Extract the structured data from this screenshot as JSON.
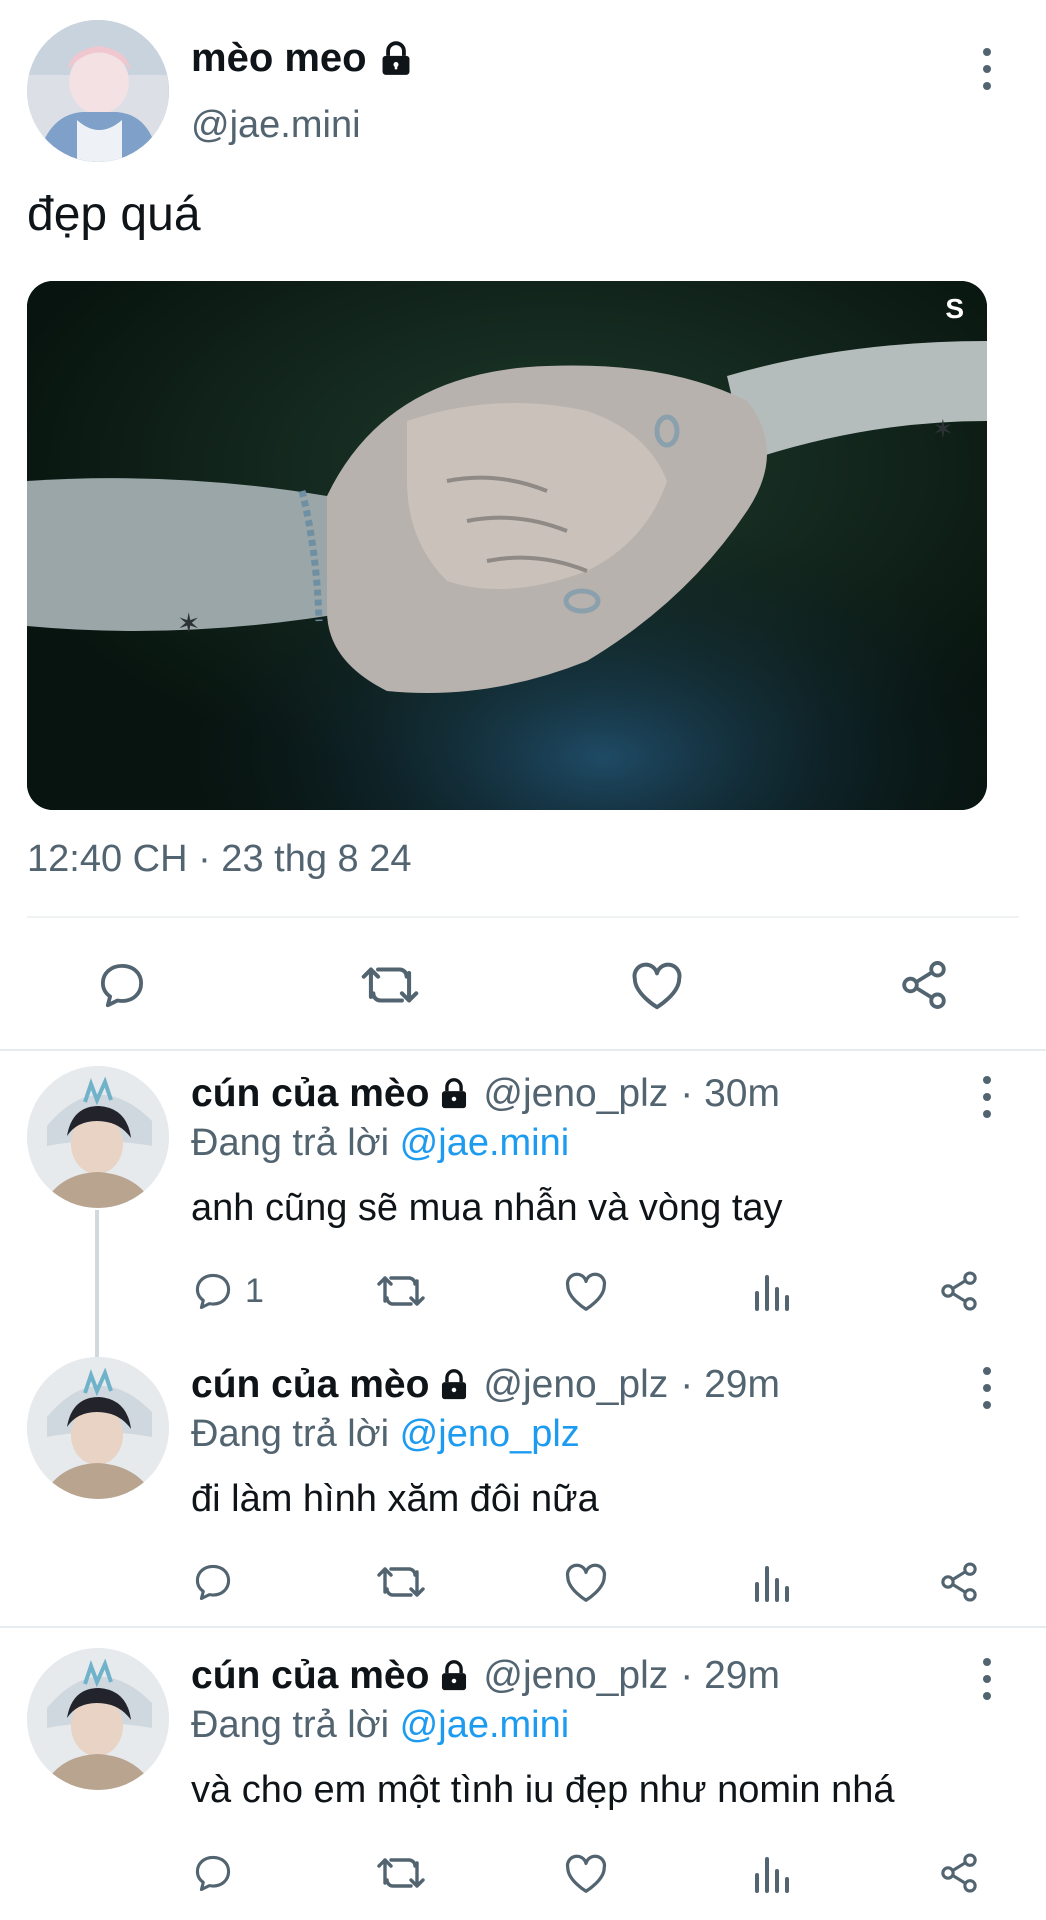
{
  "main_tweet": {
    "author_name": "mèo meo",
    "author_handle": "@jae.mini",
    "text": "đẹp quá",
    "media_watermark": "S",
    "timestamp": "12:40 CH · 23 thg 8 24"
  },
  "replies": [
    {
      "author_name": "cún của mèo",
      "author_handle": "@jeno_plz",
      "age": "· 30m",
      "replying_prefix": "Đang trả lời",
      "replying_to": "@jae.mini",
      "text": "anh cũng sẽ mua nhẫn và vòng tay",
      "reply_count": "1"
    },
    {
      "author_name": "cún của mèo",
      "author_handle": "@jeno_plz",
      "age": "· 29m",
      "replying_prefix": "Đang trả lời",
      "replying_to": "@jeno_plz",
      "text": "đi làm hình xăm đôi nữa",
      "reply_count": ""
    },
    {
      "author_name": "cún của mèo",
      "author_handle": "@jeno_plz",
      "age": "· 29m",
      "replying_prefix": "Đang trả lời",
      "replying_to": "@jae.mini",
      "text": "và cho em một tình iu đẹp như nomin nhá",
      "reply_count": ""
    }
  ],
  "colors": {
    "text": "#0f1419",
    "secondary": "#536471",
    "accent": "#1d9bf0",
    "divider": "#eff3f4"
  },
  "icons": [
    "lock-icon",
    "more-icon",
    "reply-icon",
    "retweet-icon",
    "like-icon",
    "share-icon",
    "views-icon"
  ]
}
